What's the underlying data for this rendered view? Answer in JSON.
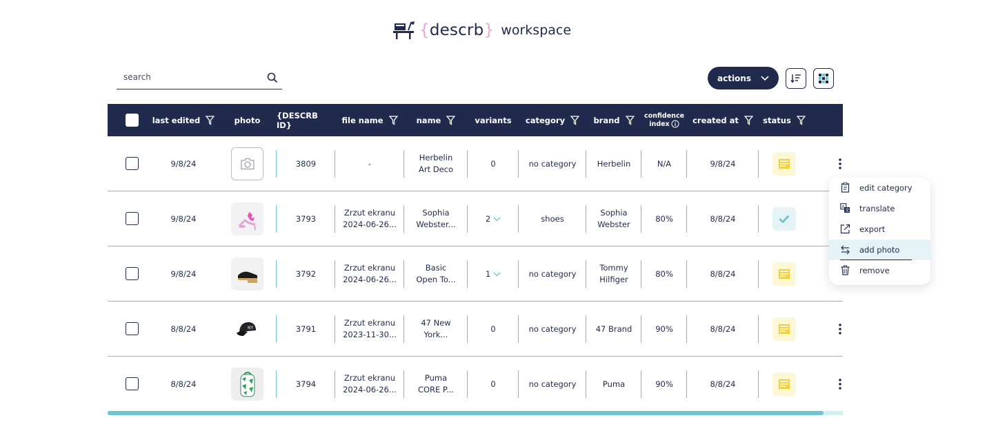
{
  "header": {
    "brand_open": "{",
    "brand_name": "descrb",
    "brand_close": "}",
    "workspace_label": "workspace"
  },
  "search": {
    "placeholder": "search"
  },
  "toolbar": {
    "actions_label": "actions"
  },
  "table": {
    "columns": {
      "last_edited": "last edited",
      "photo": "photo",
      "id": "{DESCRB ID}",
      "file_name": "file name",
      "name": "name",
      "variants": "variants",
      "category": "category",
      "brand": "brand",
      "confidence_line1": "confidence",
      "confidence_line2": "index",
      "created_at": "created at",
      "status": "status"
    },
    "rows": [
      {
        "last_edited": "9/8/24",
        "photo": "none",
        "id": "3809",
        "file_name_1": "-",
        "file_name_2": "",
        "name_1": "Herbelin",
        "name_2": "Art Deco",
        "variants": "0",
        "category": "no category",
        "brand_1": "Herbelin",
        "brand_2": "",
        "confidence": "N/A",
        "created_at": "9/8/24",
        "status": "draft"
      },
      {
        "last_edited": "9/8/24",
        "photo": "pink-sandal",
        "id": "3793",
        "file_name_1": "Zrzut ekranu",
        "file_name_2": "2024-06-26...",
        "name_1": "Sophia",
        "name_2": "Webster...",
        "variants": "2",
        "category": "shoes",
        "brand_1": "Sophia",
        "brand_2": "Webster",
        "confidence": "80%",
        "created_at": "8/8/24",
        "status": "done"
      },
      {
        "last_edited": "9/8/24",
        "photo": "black-wedge",
        "id": "3792",
        "file_name_1": "Zrzut ekranu",
        "file_name_2": "2024-06-26...",
        "name_1": "Basic",
        "name_2": "Open To...",
        "variants": "1",
        "category": "no category",
        "brand_1": "Tommy",
        "brand_2": "Hilfiger",
        "confidence": "80%",
        "created_at": "8/8/24",
        "status": "draft"
      },
      {
        "last_edited": "8/8/24",
        "photo": "black-cap",
        "id": "3791",
        "file_name_1": "Zrzut ekranu",
        "file_name_2": "2023-11-30...",
        "name_1": "47 New",
        "name_2": "York...",
        "variants": "0",
        "category": "no category",
        "brand_1": "47 Brand",
        "brand_2": "",
        "confidence": "90%",
        "created_at": "8/8/24",
        "status": "draft"
      },
      {
        "last_edited": "8/8/24",
        "photo": "green-backpack",
        "id": "3794",
        "file_name_1": "Zrzut ekranu",
        "file_name_2": "2024-06-26...",
        "name_1": "Puma",
        "name_2": "CORE P...",
        "variants": "0",
        "category": "no category",
        "brand_1": "Puma",
        "brand_2": "",
        "confidence": "90%",
        "created_at": "8/8/24",
        "status": "draft"
      }
    ]
  },
  "context_menu": {
    "items": [
      {
        "label": "edit category",
        "icon": "clipboard-icon"
      },
      {
        "label": "translate",
        "icon": "translate-icon"
      },
      {
        "label": "export",
        "icon": "export-icon"
      },
      {
        "label": "add photo",
        "icon": "swap-arrows-icon"
      },
      {
        "label": "remove",
        "icon": "trash-icon"
      }
    ],
    "active_item": "add photo"
  },
  "colors": {
    "navy": "#1f2a4d",
    "teal": "#6ec3cc",
    "draft_bg": "#fdf7d6",
    "draft_icon": "#f2d13f",
    "done_bg": "#e3f3f6",
    "brace_pink": "#e7a6cf"
  }
}
